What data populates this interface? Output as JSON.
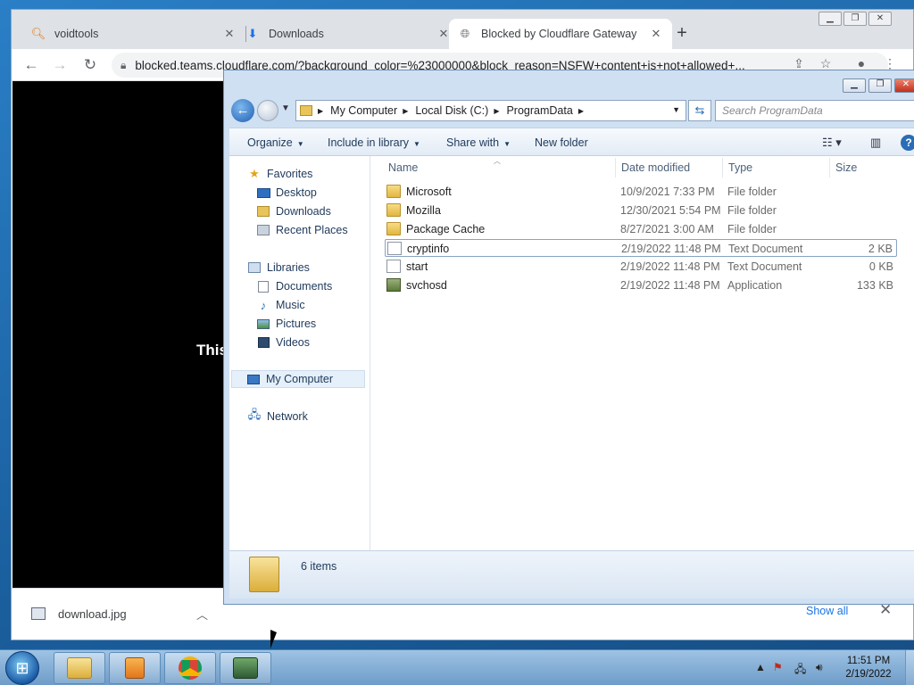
{
  "chrome": {
    "tabs": [
      {
        "label": "voidtools",
        "icon": "magnifier-icon"
      },
      {
        "label": "Downloads",
        "icon": "download-icon"
      },
      {
        "label": "Blocked by Cloudflare Gateway",
        "icon": "globe-icon"
      }
    ],
    "url": "blocked.teams.cloudflare.com/?background_color=%23000000&block_reason=NSFW+content+is+not+allowed+...",
    "page_text": "This",
    "download": {
      "filename": "download.jpg",
      "show_all": "Show all"
    }
  },
  "explorer": {
    "breadcrumb": [
      "My Computer",
      "Local Disk (C:)",
      "ProgramData"
    ],
    "search_placeholder": "Search ProgramData",
    "commands": {
      "organize": "Organize",
      "include": "Include in library",
      "share": "Share with",
      "new_folder": "New folder"
    },
    "nav": {
      "favorites": "Favorites",
      "desktop": "Desktop",
      "downloads": "Downloads",
      "recent": "Recent Places",
      "libraries": "Libraries",
      "documents": "Documents",
      "music": "Music",
      "pictures": "Pictures",
      "videos": "Videos",
      "computer": "My Computer",
      "network": "Network"
    },
    "columns": {
      "name": "Name",
      "date": "Date modified",
      "type": "Type",
      "size": "Size"
    },
    "files": [
      {
        "name": "Microsoft",
        "date": "10/9/2021 7:33 PM",
        "type": "File folder",
        "size": ""
      },
      {
        "name": "Mozilla",
        "date": "12/30/2021 5:54 PM",
        "type": "File folder",
        "size": ""
      },
      {
        "name": "Package Cache",
        "date": "8/27/2021 3:00 AM",
        "type": "File folder",
        "size": ""
      },
      {
        "name": "cryptinfo",
        "date": "2/19/2022 11:48 PM",
        "type": "Text Document",
        "size": "2 KB"
      },
      {
        "name": "start",
        "date": "2/19/2022 11:48 PM",
        "type": "Text Document",
        "size": "0 KB"
      },
      {
        "name": "svchosd",
        "date": "2/19/2022 11:48 PM",
        "type": "Application",
        "size": "133 KB"
      }
    ],
    "item_count": "6 items"
  },
  "taskbar": {
    "time": "11:51 PM",
    "date": "2/19/2022"
  }
}
